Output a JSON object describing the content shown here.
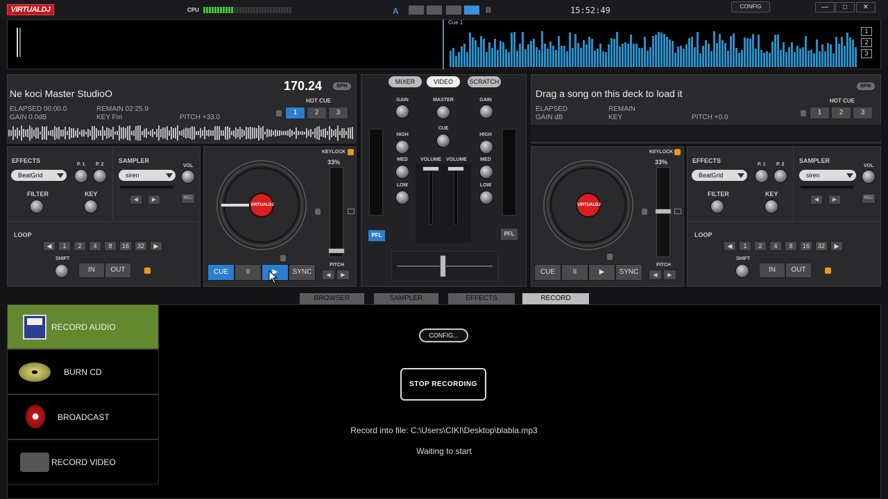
{
  "app": {
    "logo": "VIRTUALDJ",
    "cpu_label": "CPU",
    "cpu_level": 0.35,
    "layout_a": "A",
    "layout_b": "B",
    "clock": "15:52:49",
    "config": "CONFIG",
    "min": "—",
    "max": "□",
    "close": "✕"
  },
  "overview": {
    "cue_label": "Cue 1",
    "nums": [
      "1",
      "2",
      "3"
    ]
  },
  "deck_left": {
    "title": "Ne koci Master StudioO",
    "bpm": "170.24",
    "bpm_badge": "BPM",
    "elapsed": "ELAPSED 00:00.0",
    "remain": "REMAIN 02:25.9",
    "gain": "GAIN 0.0dB",
    "key": "KEY Fm",
    "pitch": "PITCH +33.0",
    "hot_cue_label": "HOT CUE",
    "hot_cues": [
      "1",
      "2",
      "3"
    ]
  },
  "deck_right": {
    "title": "Drag a song on this deck to load it",
    "bpm_badge": "BPM",
    "elapsed": "ELAPSED",
    "remain": "REMAIN",
    "gain": "GAIN dB",
    "key": "KEY",
    "pitch": "PITCH +0.0",
    "hot_cue_label": "HOT CUE",
    "hot_cues": [
      "1",
      "2",
      "3"
    ]
  },
  "fx": {
    "effects": "EFFECTS",
    "effect_value": "BeatGrid",
    "p1": "P. 1",
    "p2": "P. 2",
    "sampler": "SAMPLER",
    "sampler_value": "siren",
    "vol": "VOL",
    "rec": "REC",
    "filter": "FILTER",
    "key": "KEY",
    "loop": "LOOP",
    "loop_sizes": [
      "1",
      "2",
      "4",
      "8",
      "16",
      "32"
    ],
    "shift": "SHIFT",
    "in": "IN",
    "out": "OUT"
  },
  "player": {
    "keylock": "KEYLOCK",
    "pitch_pct": "33%",
    "pitch_lbl": "PITCH",
    "cue": "CUE",
    "pause": "II",
    "play": "▶",
    "sync": "SYNC",
    "jog_logo": "VIRTUALDJ"
  },
  "mixer": {
    "tabs": [
      "MIXER",
      "VIDEO",
      "SCRATCH"
    ],
    "gain": "GAIN",
    "master": "MASTER",
    "cue": "CUE",
    "high": "HIGH",
    "med": "MED",
    "low": "LOW",
    "volume": "VOLUME",
    "pfl": "PFL"
  },
  "browser_tabs": [
    "BROWSER",
    "SAMPLER",
    "EFFECTS",
    "RECORD"
  ],
  "record": {
    "items": [
      "RECORD AUDIO",
      "BURN CD",
      "BROADCAST",
      "RECORD VIDEO"
    ],
    "config": "CONFIG...",
    "stop": "STOP RECORDING",
    "file_line": "Record into file: C:\\Users\\CIKI\\Desktop\\blabla.mp3",
    "status": "Waiting to start"
  }
}
